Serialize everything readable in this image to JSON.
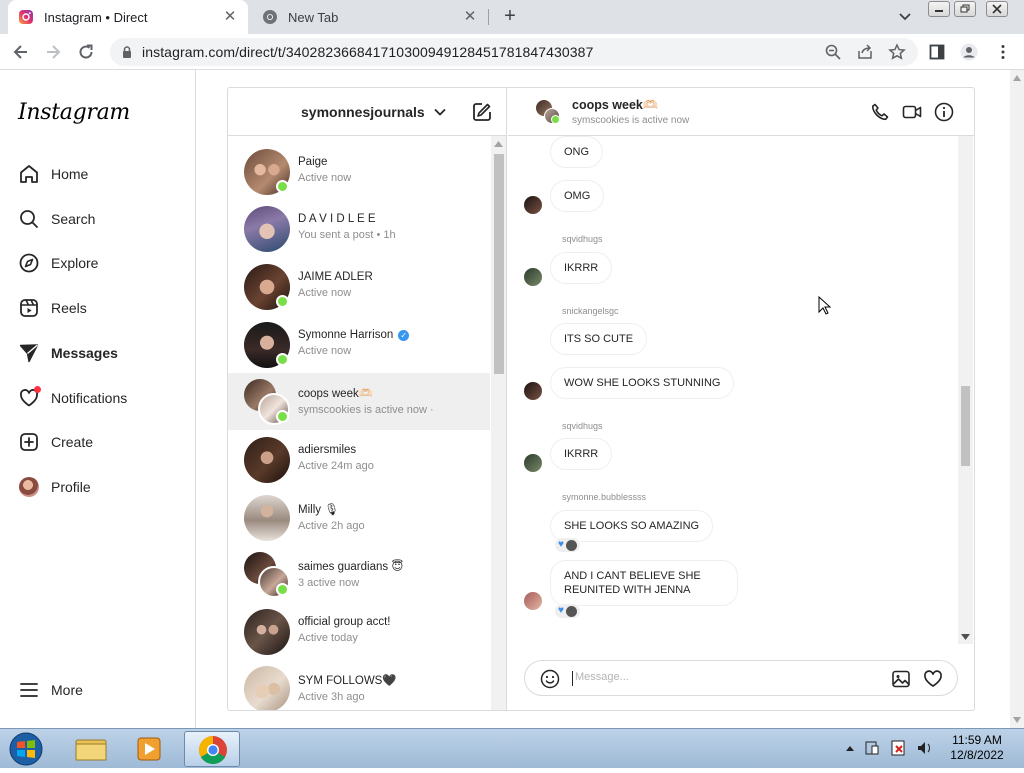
{
  "browser": {
    "tabs": [
      {
        "title": "Instagram • Direct",
        "active": true
      },
      {
        "title": "New Tab",
        "active": false
      }
    ],
    "url": "instagram.com/direct/t/340282366841710300949128451781847430387"
  },
  "sidebar": {
    "logo": "Instagram",
    "items": [
      {
        "label": "Home",
        "icon": "home-icon"
      },
      {
        "label": "Search",
        "icon": "search-icon"
      },
      {
        "label": "Explore",
        "icon": "compass-icon"
      },
      {
        "label": "Reels",
        "icon": "reels-icon"
      },
      {
        "label": "Messages",
        "icon": "messages-icon"
      },
      {
        "label": "Notifications",
        "icon": "heart-icon"
      },
      {
        "label": "Create",
        "icon": "plus-square-icon"
      },
      {
        "label": "Profile",
        "icon": "avatar"
      }
    ],
    "more_label": "More"
  },
  "inbox": {
    "account": "symonnesjournals",
    "threads": [
      {
        "name": "Paige",
        "sub": "Active now",
        "online": true
      },
      {
        "name": "D A V I D L E E",
        "sub": "You sent a post • 1h",
        "online": false
      },
      {
        "name": "JAIME ADLER",
        "sub": "Active now",
        "online": true
      },
      {
        "name": "Symonne Harrison",
        "sub": "Active now",
        "online": true,
        "verified": true
      },
      {
        "name": "coops week🫶🏻",
        "sub": "symscookies is active now ·",
        "online": true,
        "selected": true,
        "group": true
      },
      {
        "name": "adiersmiles",
        "sub": "Active 24m ago",
        "online": false
      },
      {
        "name": "Milly 🎙",
        "sub": "Active 2h ago",
        "online": false
      },
      {
        "name": "saimes guardians 😇",
        "sub": "3 active now",
        "online": true,
        "group": true
      },
      {
        "name": "official group acct!",
        "sub": "Active today",
        "online": false
      },
      {
        "name": "SYM FOLLOWS🖤",
        "sub": "Active 3h ago",
        "online": false
      }
    ]
  },
  "chat": {
    "title": "coops week🫶🏻",
    "status": "symscookies is active now",
    "messages": [
      {
        "sender": "",
        "text": "ONG"
      },
      {
        "sender": "",
        "text": "OMG"
      },
      {
        "sender": "sqvidhugs",
        "text": "IKRRR"
      },
      {
        "sender": "snickangelsgc",
        "text": "ITS SO CUTE"
      },
      {
        "sender": "",
        "text": "WOW SHE LOOKS STUNNING"
      },
      {
        "sender": "sqvidhugs",
        "text": "IKRRR"
      },
      {
        "sender": "symonne.bubblessss",
        "text": "SHE LOOKS SO AMAZING"
      },
      {
        "sender": "",
        "text": "AND I CANT BELIEVE SHE REUNITED WITH JENNA"
      }
    ],
    "composer_placeholder": "Message..."
  },
  "taskbar": {
    "time": "11:59 AM",
    "date": "12/8/2022"
  },
  "colors": {
    "online": "#78de45",
    "verified": "#3897f0",
    "reaction_heart": "#3b8ee8",
    "notification_dot": "#ff3040"
  }
}
